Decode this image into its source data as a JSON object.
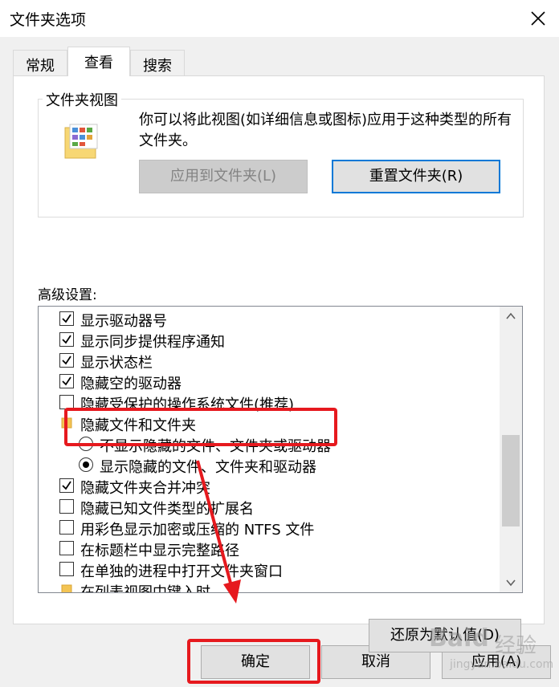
{
  "window": {
    "title": "文件夹选项"
  },
  "tabs": [
    {
      "label": "常规"
    },
    {
      "label": "查看"
    },
    {
      "label": "搜索"
    }
  ],
  "folder_view": {
    "legend": "文件夹视图",
    "description": "你可以将此视图(如详细信息或图标)应用于这种类型的所有文件夹。",
    "apply_button": "应用到文件夹(L)",
    "reset_button": "重置文件夹(R)"
  },
  "advanced": {
    "label": "高级设置:",
    "items": [
      {
        "type": "checkbox",
        "checked": true,
        "label": "显示驱动器号"
      },
      {
        "type": "checkbox",
        "checked": true,
        "label": "显示同步提供程序通知"
      },
      {
        "type": "checkbox",
        "checked": true,
        "label": "显示状态栏"
      },
      {
        "type": "checkbox",
        "checked": true,
        "label": "隐藏空的驱动器"
      },
      {
        "type": "checkbox",
        "checked": false,
        "label": "隐藏受保护的操作系统文件(推荐)"
      },
      {
        "type": "folder",
        "label": "隐藏文件和文件夹"
      },
      {
        "type": "radio",
        "checked": false,
        "label": "不显示隐藏的文件、文件夹或驱动器"
      },
      {
        "type": "radio",
        "checked": true,
        "label": "显示隐藏的文件、文件夹和驱动器"
      },
      {
        "type": "checkbox",
        "checked": true,
        "label": "隐藏文件夹合并冲突"
      },
      {
        "type": "checkbox",
        "checked": false,
        "label": "隐藏已知文件类型的扩展名"
      },
      {
        "type": "checkbox",
        "checked": false,
        "label": "用彩色显示加密或压缩的 NTFS 文件"
      },
      {
        "type": "checkbox",
        "checked": false,
        "label": "在标题栏中显示完整路径"
      },
      {
        "type": "checkbox",
        "checked": false,
        "label": "在单独的进程中打开文件夹窗口"
      },
      {
        "type": "folder",
        "label": "在列表视图中键入时"
      }
    ],
    "restore_button": "还原为默认值(D)"
  },
  "footer": {
    "ok": "确定",
    "cancel": "取消",
    "apply": "应用(A)"
  },
  "watermark": {
    "brand": "Baid",
    "jingyan": "经验",
    "url": "jingyan.baidu.com"
  },
  "colors": {
    "annotation": "#e6191e",
    "focus_border": "#0078d7"
  }
}
